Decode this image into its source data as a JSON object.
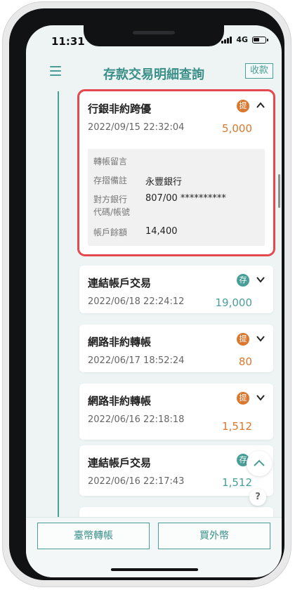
{
  "status_bar": {
    "time": "11:31",
    "network": "4G"
  },
  "header": {
    "title": "存款交易明細查詢",
    "collapse_label": "收款"
  },
  "transactions": [
    {
      "name": "行銀非約跨優",
      "datetime": "2022/09/15   22:32:04",
      "badge": "提",
      "amount": "5,000",
      "type": "withdraw",
      "expanded": true,
      "details": {
        "memo_label": "轉帳留言",
        "note_label": "存摺備註",
        "note_value": "永豐銀行",
        "counterparty_label_1": "對方銀行",
        "counterparty_label_2": "代碼/帳號",
        "counterparty_value": "807/00 **********",
        "balance_label": "帳戶餘額",
        "balance_value": "14,400"
      }
    },
    {
      "name": "連結帳戶交易",
      "datetime": "2022/06/18 22:24:12",
      "badge": "存",
      "amount": "19,000",
      "type": "deposit"
    },
    {
      "name": "網路非約轉帳",
      "datetime": "2022/06/17 18:52:24",
      "badge": "提",
      "amount": "80",
      "type": "withdraw"
    },
    {
      "name": "網路非約轉帳",
      "datetime": "2022/06/16 22:18:18",
      "badge": "提",
      "amount": "1,512",
      "type": "withdraw"
    },
    {
      "name": "連結帳戶交易",
      "datetime": "2022/06/16 22:17:43",
      "badge": "存",
      "amount": "1,512",
      "type": "deposit"
    }
  ],
  "floating": {
    "help_label": "?"
  },
  "bottom_buttons": {
    "twd_transfer": "臺幣轉帳",
    "buy_foreign": "買外幣"
  },
  "colors": {
    "accent": "#4a9e98",
    "withdraw": "#d9782e",
    "deposit": "#4a9e98",
    "highlight": "#e5484d"
  }
}
